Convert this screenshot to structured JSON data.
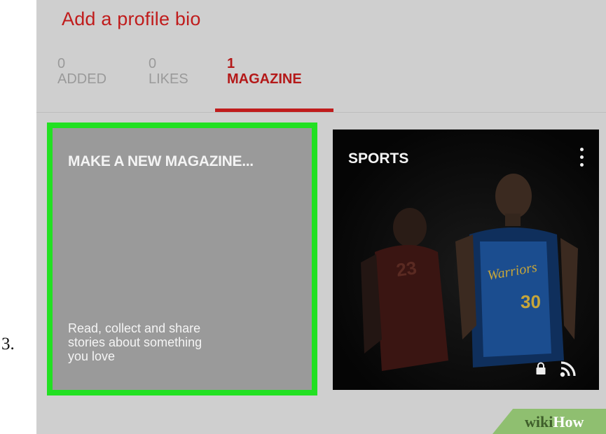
{
  "step": {
    "number": "3."
  },
  "profile": {
    "bio_link": "Add a profile bio"
  },
  "stats": [
    {
      "count": "0",
      "label": "ADDED"
    },
    {
      "count": "0",
      "label": "LIKES"
    },
    {
      "count": "1",
      "label": "MAGAZINE",
      "active": true
    }
  ],
  "cards": {
    "new_magazine": {
      "title": "MAKE A NEW MAGAZINE...",
      "description": "Read, collect and share\nstories about something\nyou love",
      "highlight_color": "#22e022"
    },
    "sports": {
      "title": "SPORTS",
      "menu_icon": "more-vert-icon",
      "status_icons": [
        "lock-icon",
        "rss-icon"
      ],
      "image": "basketball-player-photo"
    }
  },
  "watermark": {
    "part1": "wiki",
    "part2": "How"
  },
  "colors": {
    "accent": "#c01c1c",
    "background": "#cfcfcf",
    "card_gray": "#9a9a9a"
  }
}
